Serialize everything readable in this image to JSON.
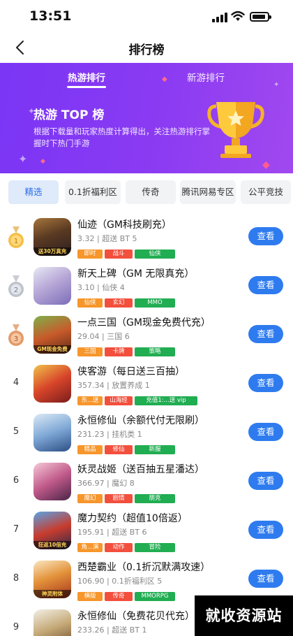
{
  "status_bar": {
    "time": "13:51"
  },
  "nav": {
    "title": "排行榜"
  },
  "banner": {
    "tabs": [
      "热游排行",
      "新游排行"
    ],
    "heading": "热游 TOP 榜",
    "description": "根据下载量和玩家热度计算得出，关注热游排行掌握时下热门手游"
  },
  "filters": [
    "精选",
    "0.1折福利区",
    "传奇",
    "腾讯网易专区",
    "公平竞技"
  ],
  "games": [
    {
      "rank": "1",
      "name": "仙迹（GM科技刷充）",
      "size": "3.32",
      "category": "超送 BT 5",
      "tags": [
        {
          "text": "即时",
          "color": "orange"
        },
        {
          "text": "战斗",
          "color": "red"
        },
        {
          "text": "仙侠",
          "color": "green"
        }
      ],
      "button": "查看",
      "icon_caption": "送30万真充"
    },
    {
      "rank": "2",
      "name": "新天上碑（GM 无限真充）",
      "size": "3.10",
      "category": "仙侠 4",
      "tags": [
        {
          "text": "仙侠",
          "color": "orange"
        },
        {
          "text": "玄幻",
          "color": "red"
        },
        {
          "text": "MMO",
          "color": "green"
        }
      ],
      "button": "查看",
      "icon_caption": ""
    },
    {
      "rank": "3",
      "name": "一点三国（GM现金免费代充）",
      "size": "29.04",
      "category": "三国 6",
      "tags": [
        {
          "text": "三国",
          "color": "orange"
        },
        {
          "text": "卡牌",
          "color": "red"
        },
        {
          "text": "策略",
          "color": "green"
        }
      ],
      "button": "查看",
      "icon_caption": "GM现金免费"
    },
    {
      "rank": "4",
      "name": "侠客游（每日送三百抽）",
      "size": "357.34",
      "category": "放置养成 1",
      "tags": [
        {
          "text": "东...送",
          "color": "orange"
        },
        {
          "text": "山海经",
          "color": "red"
        },
        {
          "text": "充值1:...送 vip",
          "color": "green"
        }
      ],
      "button": "查看",
      "icon_caption": ""
    },
    {
      "rank": "5",
      "name": "永恒修仙（余额代付无限刷）",
      "size": "231.23",
      "category": "挂机类 1",
      "tags": [
        {
          "text": "精品",
          "color": "orange"
        },
        {
          "text": "修仙",
          "color": "red"
        },
        {
          "text": "新服",
          "color": "green"
        }
      ],
      "button": "查看",
      "icon_caption": ""
    },
    {
      "rank": "6",
      "name": "妖灵战姬（送百抽五星潘达）",
      "size": "366.97",
      "category": "魔幻 8",
      "tags": [
        {
          "text": "魔幻",
          "color": "orange"
        },
        {
          "text": "剧情",
          "color": "red"
        },
        {
          "text": "朋克",
          "color": "green"
        }
      ],
      "button": "查看",
      "icon_caption": ""
    },
    {
      "rank": "7",
      "name": "魔力契约（超值10倍返）",
      "size": "195.91",
      "category": "超送 BT 6",
      "tags": [
        {
          "text": "角...演",
          "color": "orange"
        },
        {
          "text": "动作",
          "color": "red"
        },
        {
          "text": "冒险",
          "color": "green"
        }
      ],
      "button": "查看",
      "icon_caption": "狂返10倍充"
    },
    {
      "rank": "8",
      "name": "西楚霸业（0.1折沉默满攻速）",
      "size": "106.90",
      "category": "0.1折福利区 5",
      "tags": [
        {
          "text": "横版",
          "color": "orange"
        },
        {
          "text": "传奇",
          "color": "red"
        },
        {
          "text": "MMORPG",
          "color": "green"
        }
      ],
      "button": "查看",
      "icon_caption": "神灵附体"
    },
    {
      "rank": "9",
      "name": "永恒修仙（免费花贝代充）",
      "size": "233.26",
      "category": "超送 BT 1",
      "tags": [],
      "button": "查看",
      "icon_caption": ""
    }
  ],
  "watermark": "就收资源站"
}
